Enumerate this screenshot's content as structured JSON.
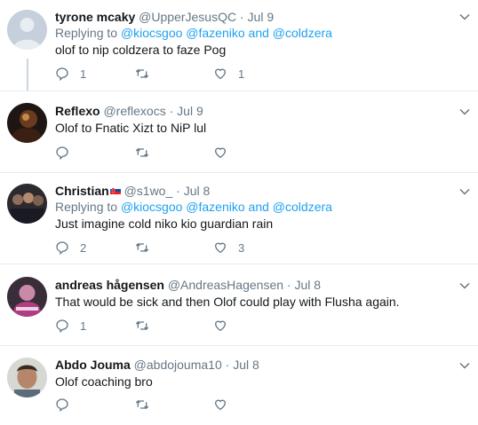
{
  "tweets": [
    {
      "name": "tyrone mcaky",
      "handle": "@UpperJesusQC",
      "separator": "·",
      "date": "Jul 9",
      "replying_prefix": "Replying to",
      "mentions": [
        "@kiocsgoo",
        "@fazeniko",
        "@coldzera"
      ],
      "mention_joiner": "and",
      "text": "olof to nip coldzera to faze Pog",
      "reply_count": "1",
      "retweet_count": "",
      "like_count": "1",
      "avatar": "default-avatar"
    },
    {
      "name": "Reflexo",
      "handle": "@reflexocs",
      "separator": "·",
      "date": "Jul 9",
      "text": "Olof to Fnatic Xizt to NiP lul",
      "reply_count": "",
      "retweet_count": "",
      "like_count": "",
      "avatar": "dark-photo-avatar"
    },
    {
      "name": "Christian",
      "handle": "@s1wo_",
      "separator": "·",
      "date": "Jul 8",
      "replying_prefix": "Replying to",
      "mentions": [
        "@kiocsgoo",
        "@fazeniko",
        "@coldzera"
      ],
      "mention_joiner": "and",
      "text": "Just imagine cold niko kio guardian rain",
      "reply_count": "2",
      "retweet_count": "",
      "like_count": "3",
      "avatar": "group-photo-avatar"
    },
    {
      "name": "andreas hågensen",
      "handle": "@AndreasHagensen",
      "separator": "·",
      "date": "Jul 8",
      "text": "That would be sick and then Olof could play with Flusha again.",
      "reply_count": "1",
      "retweet_count": "",
      "like_count": "",
      "avatar": "pink-photo-avatar"
    },
    {
      "name": "Abdo Jouma",
      "handle": "@abdojouma10",
      "separator": "·",
      "date": "Jul 8",
      "text": "Olof coaching bro",
      "reply_count": "",
      "retweet_count": "",
      "like_count": "",
      "avatar": "face-photo-avatar"
    }
  ],
  "colors": {
    "link": "#1da1f2",
    "muted": "#657786",
    "text": "#14171a",
    "divider": "#e6ecf0"
  },
  "icons": {
    "reply": "reply-icon",
    "retweet": "retweet-icon",
    "like": "heart-icon",
    "more": "chevron-down-icon"
  }
}
